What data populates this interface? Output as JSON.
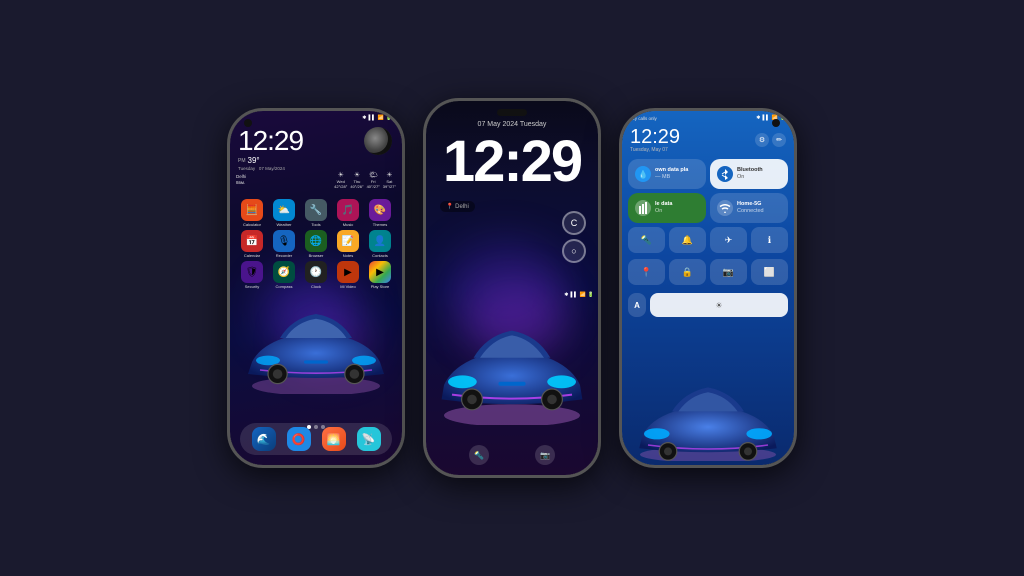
{
  "background": "#1a1a2e",
  "phone1": {
    "time": "12:29",
    "temp": "39°",
    "period": "PM",
    "date": "07 May/2024",
    "location": "Delhi",
    "weather": "8вм.",
    "days": [
      {
        "day": "Wed",
        "hi": "42°/28°"
      },
      {
        "day": "Thu",
        "hi": "40°/26°"
      },
      {
        "day": "Fri",
        "hi": "40°/27°"
      },
      {
        "day": "Sat",
        "hi": "39°/27°"
      }
    ],
    "apps_row1": [
      {
        "label": "Calculator",
        "color": "#e64a19",
        "icon": "🧮"
      },
      {
        "label": "Weather",
        "color": "#0288d1",
        "icon": "⛅"
      },
      {
        "label": "Tools",
        "color": "#455a64",
        "icon": "🔧"
      },
      {
        "label": "Music",
        "color": "#ad1457",
        "icon": "🎵"
      },
      {
        "label": "Themes",
        "color": "#6a1b9a",
        "icon": "🎨"
      }
    ],
    "apps_row2": [
      {
        "label": "Calendar",
        "color": "#c62828",
        "icon": "📅"
      },
      {
        "label": "Recorder",
        "color": "#1565c0",
        "icon": "🎙"
      },
      {
        "label": "Browser",
        "color": "#1b5e20",
        "icon": "🌐"
      },
      {
        "label": "Notes",
        "color": "#f9a825",
        "icon": "📝"
      },
      {
        "label": "Contacts",
        "color": "#00838f",
        "icon": "👤"
      }
    ],
    "apps_row3": [
      {
        "label": "Security",
        "color": "#4a148c",
        "icon": "🛡"
      },
      {
        "label": "Compass",
        "color": "#004d40",
        "icon": "🧭"
      },
      {
        "label": "Clock",
        "color": "#212121",
        "icon": "🕐"
      },
      {
        "label": "Mi Video",
        "color": "#bf360c",
        "icon": "▶"
      },
      {
        "label": "Play Store",
        "color": "#1565c0",
        "icon": "▶"
      }
    ],
    "dock": [
      {
        "icon": "🌊",
        "color": "#1565c0"
      },
      {
        "icon": "⭕",
        "color": "#42a5f5"
      },
      {
        "icon": "🌅",
        "color": "#ff7043"
      },
      {
        "icon": "📡",
        "color": "#26c6da"
      }
    ]
  },
  "phone2": {
    "date": "07 May 2024  Tuesday",
    "time": "12:29",
    "location": "Delhi"
  },
  "phone3": {
    "status_left": "ncy calls only",
    "time": "12:29",
    "date": "Tuesday, May 07",
    "tiles": [
      {
        "title": "own data pla",
        "sub": "— MB",
        "icon": "💧",
        "type": "blue"
      },
      {
        "title": "Bluetooth",
        "sub": "On",
        "icon": "🔵",
        "type": "white"
      },
      {
        "title": "le data",
        "sub": "On",
        "icon": "📶",
        "type": "green"
      },
      {
        "title": "Home-5G",
        "sub": "Connected",
        "icon": "📶",
        "type": "gray"
      }
    ],
    "small_icons_row1": [
      "🔦",
      "🔔",
      "✈",
      "ℹ"
    ],
    "small_icons_row2": [
      "📍",
      "🔒",
      "📷",
      "⬜"
    ],
    "brightness_label": "A"
  }
}
